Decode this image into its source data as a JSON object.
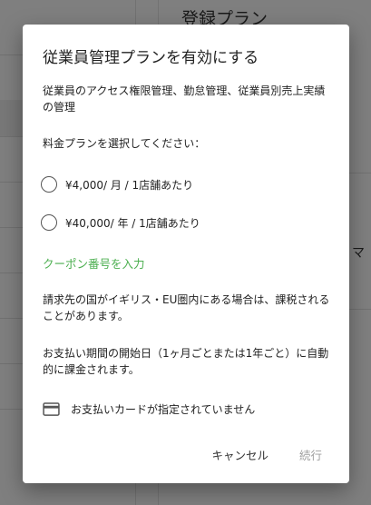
{
  "background": {
    "title": "登録プラン",
    "side_text": "マ"
  },
  "dialog": {
    "title": "従業員管理プランを有効にする",
    "description": "従業員のアクセス権限管理、勤怠管理、従業員別売上実績の管理",
    "plan_prompt": "料金プランを選択してください：",
    "plans": [
      {
        "label": "¥4,000/ 月 / 1店舗あたり",
        "selected": false
      },
      {
        "label": "¥40,000/ 年 / 1店舗あたり",
        "selected": false
      }
    ],
    "coupon_link": "クーポン番号を入力",
    "tax_note": "請求先の国がイギリス・EU圏内にある場合は、課税されることがあります。",
    "billing_note": "お支払い期間の開始日（1ヶ月ごとまたは1年ごと）に自動的に課金されます。",
    "card_status": "お支払いカードが指定されていません",
    "card_icon": "credit-card-icon",
    "buttons": {
      "cancel": "キャンセル",
      "continue": "続行"
    }
  },
  "colors": {
    "accent_link": "#4caf50",
    "disabled_text": "#9e9e9e",
    "scrim": "rgba(0,0,0,0.50)"
  }
}
